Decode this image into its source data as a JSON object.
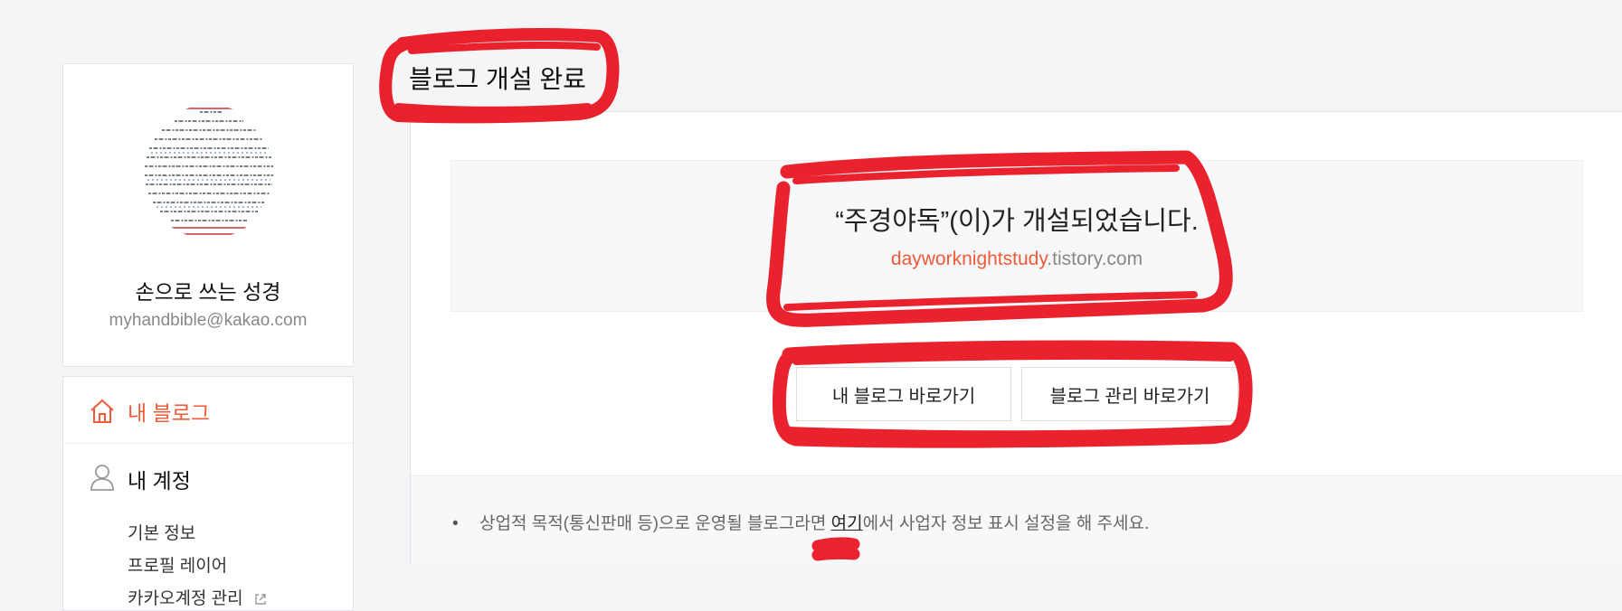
{
  "sidebar": {
    "profile": {
      "name": "손으로 쓰는 성경",
      "email": "myhandbible@kakao.com"
    },
    "menu": {
      "my_blog": {
        "label": "내 블로그",
        "icon": "home-icon",
        "active_color": "#f05a38"
      },
      "account": {
        "label": "내 계정",
        "icon": "user-icon",
        "items": [
          {
            "label": "기본 정보"
          },
          {
            "label": "프로필 레이어"
          },
          {
            "label": "카카오계정 관리",
            "icon": "external-link-icon"
          }
        ]
      }
    }
  },
  "main": {
    "title": "블로그 개설 완료",
    "notice": {
      "message": "“주경야독”(이)가 개설되었습니다.",
      "url_subdomain": "dayworknightstudy",
      "url_domain": ".tistory.com"
    },
    "buttons": {
      "go_my_blog": "내 블로그 바로가기",
      "go_manage": "블로그 관리 바로가기"
    },
    "footer": {
      "bullet": "•",
      "text_before": "상업적 목적(통신판매 등)으로 운영될 블로그라면 ",
      "link": "여기",
      "text_after": "에서 사업자 정보 표시 설정을 해 주세요."
    }
  },
  "colors": {
    "accent": "#f05a38",
    "marker": "#e8101c",
    "background": "#f4f5f7"
  }
}
